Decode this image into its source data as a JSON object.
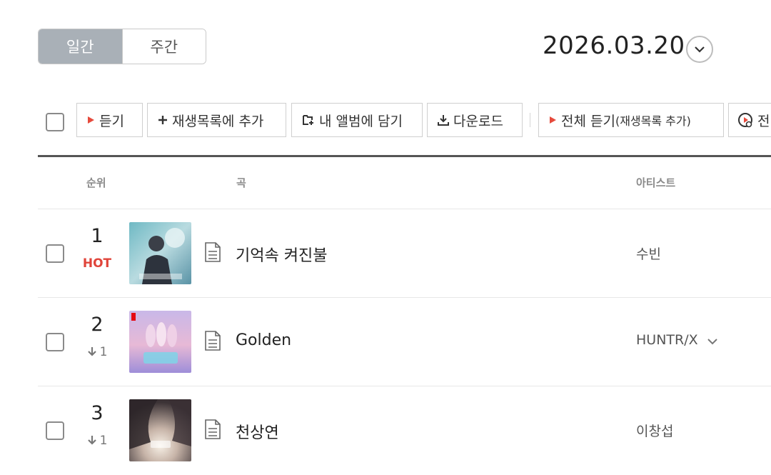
{
  "period_tabs": [
    {
      "label": "일간",
      "active": true
    },
    {
      "label": "주간",
      "active": false
    }
  ],
  "date": "2026.03.20",
  "toolbar": {
    "listen": "듣기",
    "add_playlist": "재생목록에 추가",
    "add_album": "내 앨범에 담기",
    "download": "다운로드",
    "listen_all": "전체 듣기",
    "listen_all_sub": "(재생목록 추가)",
    "last_partial": "전"
  },
  "table": {
    "headers": {
      "rank": "순위",
      "song": "곡",
      "artist": "아티스트"
    },
    "rows": [
      {
        "rank": "1",
        "change": "HOT",
        "change_type": "hot",
        "title": "기억속 켜진불",
        "artist": "수빈",
        "artist_more": false
      },
      {
        "rank": "2",
        "change": "1",
        "change_type": "down",
        "title": "Golden",
        "artist": "HUNTR/X",
        "artist_more": true
      },
      {
        "rank": "3",
        "change": "1",
        "change_type": "down",
        "title": "천상연",
        "artist": "이창섭",
        "artist_more": false
      }
    ]
  },
  "colors": {
    "accent_red": "#e64a3c",
    "hot_red": "#e0443a",
    "active_tab_bg": "#a9b0b7"
  }
}
